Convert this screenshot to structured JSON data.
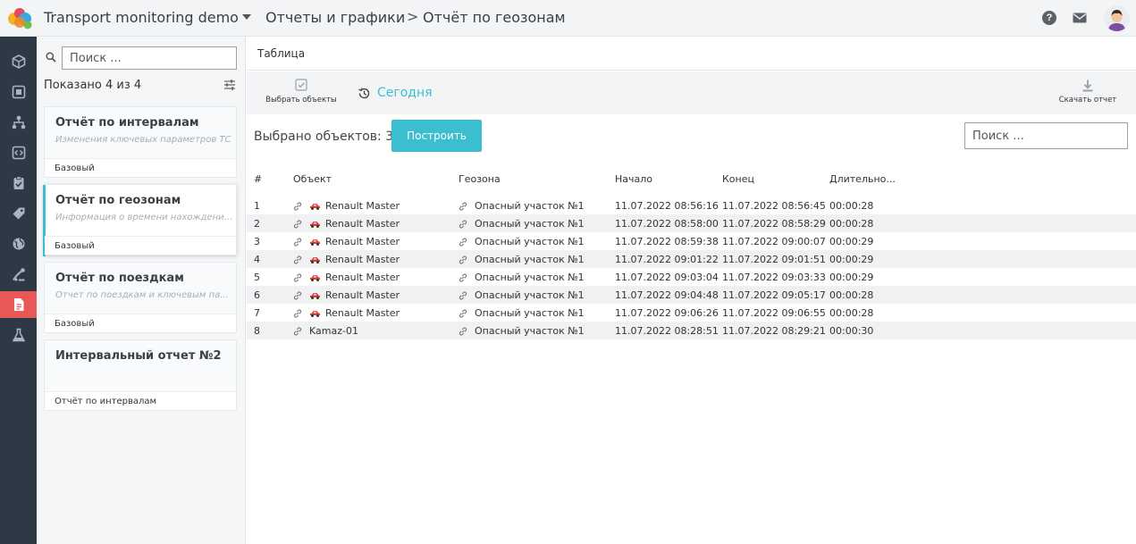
{
  "header": {
    "app_title": "Transport monitoring demo",
    "breadcrumb_section": "Отчеты и графики",
    "breadcrumb_separator": ">",
    "breadcrumb_page": "Отчёт по геозонам",
    "help_glyph": "?"
  },
  "icons": {
    "logo": "multicolor-logo-icon",
    "help": "help-circle-icon",
    "mail": "envelope-icon",
    "avatar": "user-avatar-icon",
    "rail": [
      "cube-icon",
      "square-target-icon",
      "hierarchy-icon",
      "code-window-icon",
      "clipboard-check-icon",
      "tag-icon",
      "globe-icon",
      "road-icon",
      "report-document-icon",
      "flask-icon"
    ],
    "search": "magnifier-icon",
    "filter": "sliders-icon",
    "select_objects": "checkbox-icon",
    "today": "history-clock-icon",
    "download": "download-arrow-icon",
    "row_link": "link-icon",
    "row_car": "red-car-icon"
  },
  "colors": {
    "accent": "#3bbfcf",
    "rail_bg": "#2d3945",
    "rail_active": "#e95757",
    "car": "#d9443a"
  },
  "sidebar": {
    "search_placeholder": "Поиск ...",
    "shown_text": "Показано 4 из 4",
    "reports": [
      {
        "title": "Отчёт по интервалам",
        "description": "Изменения ключевых параметров ТС",
        "type": "Базовый",
        "active": false
      },
      {
        "title": "Отчёт по геозонам",
        "description": "Информация о времени нахождения...",
        "type": "Базовый",
        "active": true
      },
      {
        "title": "Отчёт по поездкам",
        "description": "Отчет по поездкам и ключевым пара...",
        "type": "Базовый",
        "active": false
      },
      {
        "title": "Интервальный отчет №2",
        "description": "",
        "type": "Отчёт по интервалам",
        "active": false
      }
    ]
  },
  "main": {
    "tab_label": "Таблица",
    "toolbar": {
      "select_objects_label": "Выбрать объекты",
      "period_label": "Сегодня",
      "download_label": "Скачать отчет"
    },
    "selected_text": "Выбрано объектов: 3",
    "build_button": "Построить",
    "search_placeholder": "Поиск ...",
    "table": {
      "columns": [
        "#",
        "Объект",
        "Геозона",
        "Начало",
        "Конец",
        "Длительно..."
      ],
      "rows": [
        {
          "num": "1",
          "object": "Renault Master",
          "car": true,
          "zone": "Опасный участок №1",
          "start": "11.07.2022 08:56:16",
          "end": "11.07.2022 08:56:45",
          "duration": "00:00:28"
        },
        {
          "num": "2",
          "object": "Renault Master",
          "car": true,
          "zone": "Опасный участок №1",
          "start": "11.07.2022 08:58:00",
          "end": "11.07.2022 08:58:29",
          "duration": "00:00:28"
        },
        {
          "num": "3",
          "object": "Renault Master",
          "car": true,
          "zone": "Опасный участок №1",
          "start": "11.07.2022 08:59:38",
          "end": "11.07.2022 09:00:07",
          "duration": "00:00:29"
        },
        {
          "num": "4",
          "object": "Renault Master",
          "car": true,
          "zone": "Опасный участок №1",
          "start": "11.07.2022 09:01:22",
          "end": "11.07.2022 09:01:51",
          "duration": "00:00:29"
        },
        {
          "num": "5",
          "object": "Renault Master",
          "car": true,
          "zone": "Опасный участок №1",
          "start": "11.07.2022 09:03:04",
          "end": "11.07.2022 09:03:33",
          "duration": "00:00:29"
        },
        {
          "num": "6",
          "object": "Renault Master",
          "car": true,
          "zone": "Опасный участок №1",
          "start": "11.07.2022 09:04:48",
          "end": "11.07.2022 09:05:17",
          "duration": "00:00:28"
        },
        {
          "num": "7",
          "object": "Renault Master",
          "car": true,
          "zone": "Опасный участок №1",
          "start": "11.07.2022 09:06:26",
          "end": "11.07.2022 09:06:55",
          "duration": "00:00:28"
        },
        {
          "num": "8",
          "object": "Kamaz-01",
          "car": false,
          "zone": "Опасный участок №1",
          "start": "11.07.2022 08:28:51",
          "end": "11.07.2022 08:29:21",
          "duration": "00:00:30"
        }
      ]
    }
  }
}
